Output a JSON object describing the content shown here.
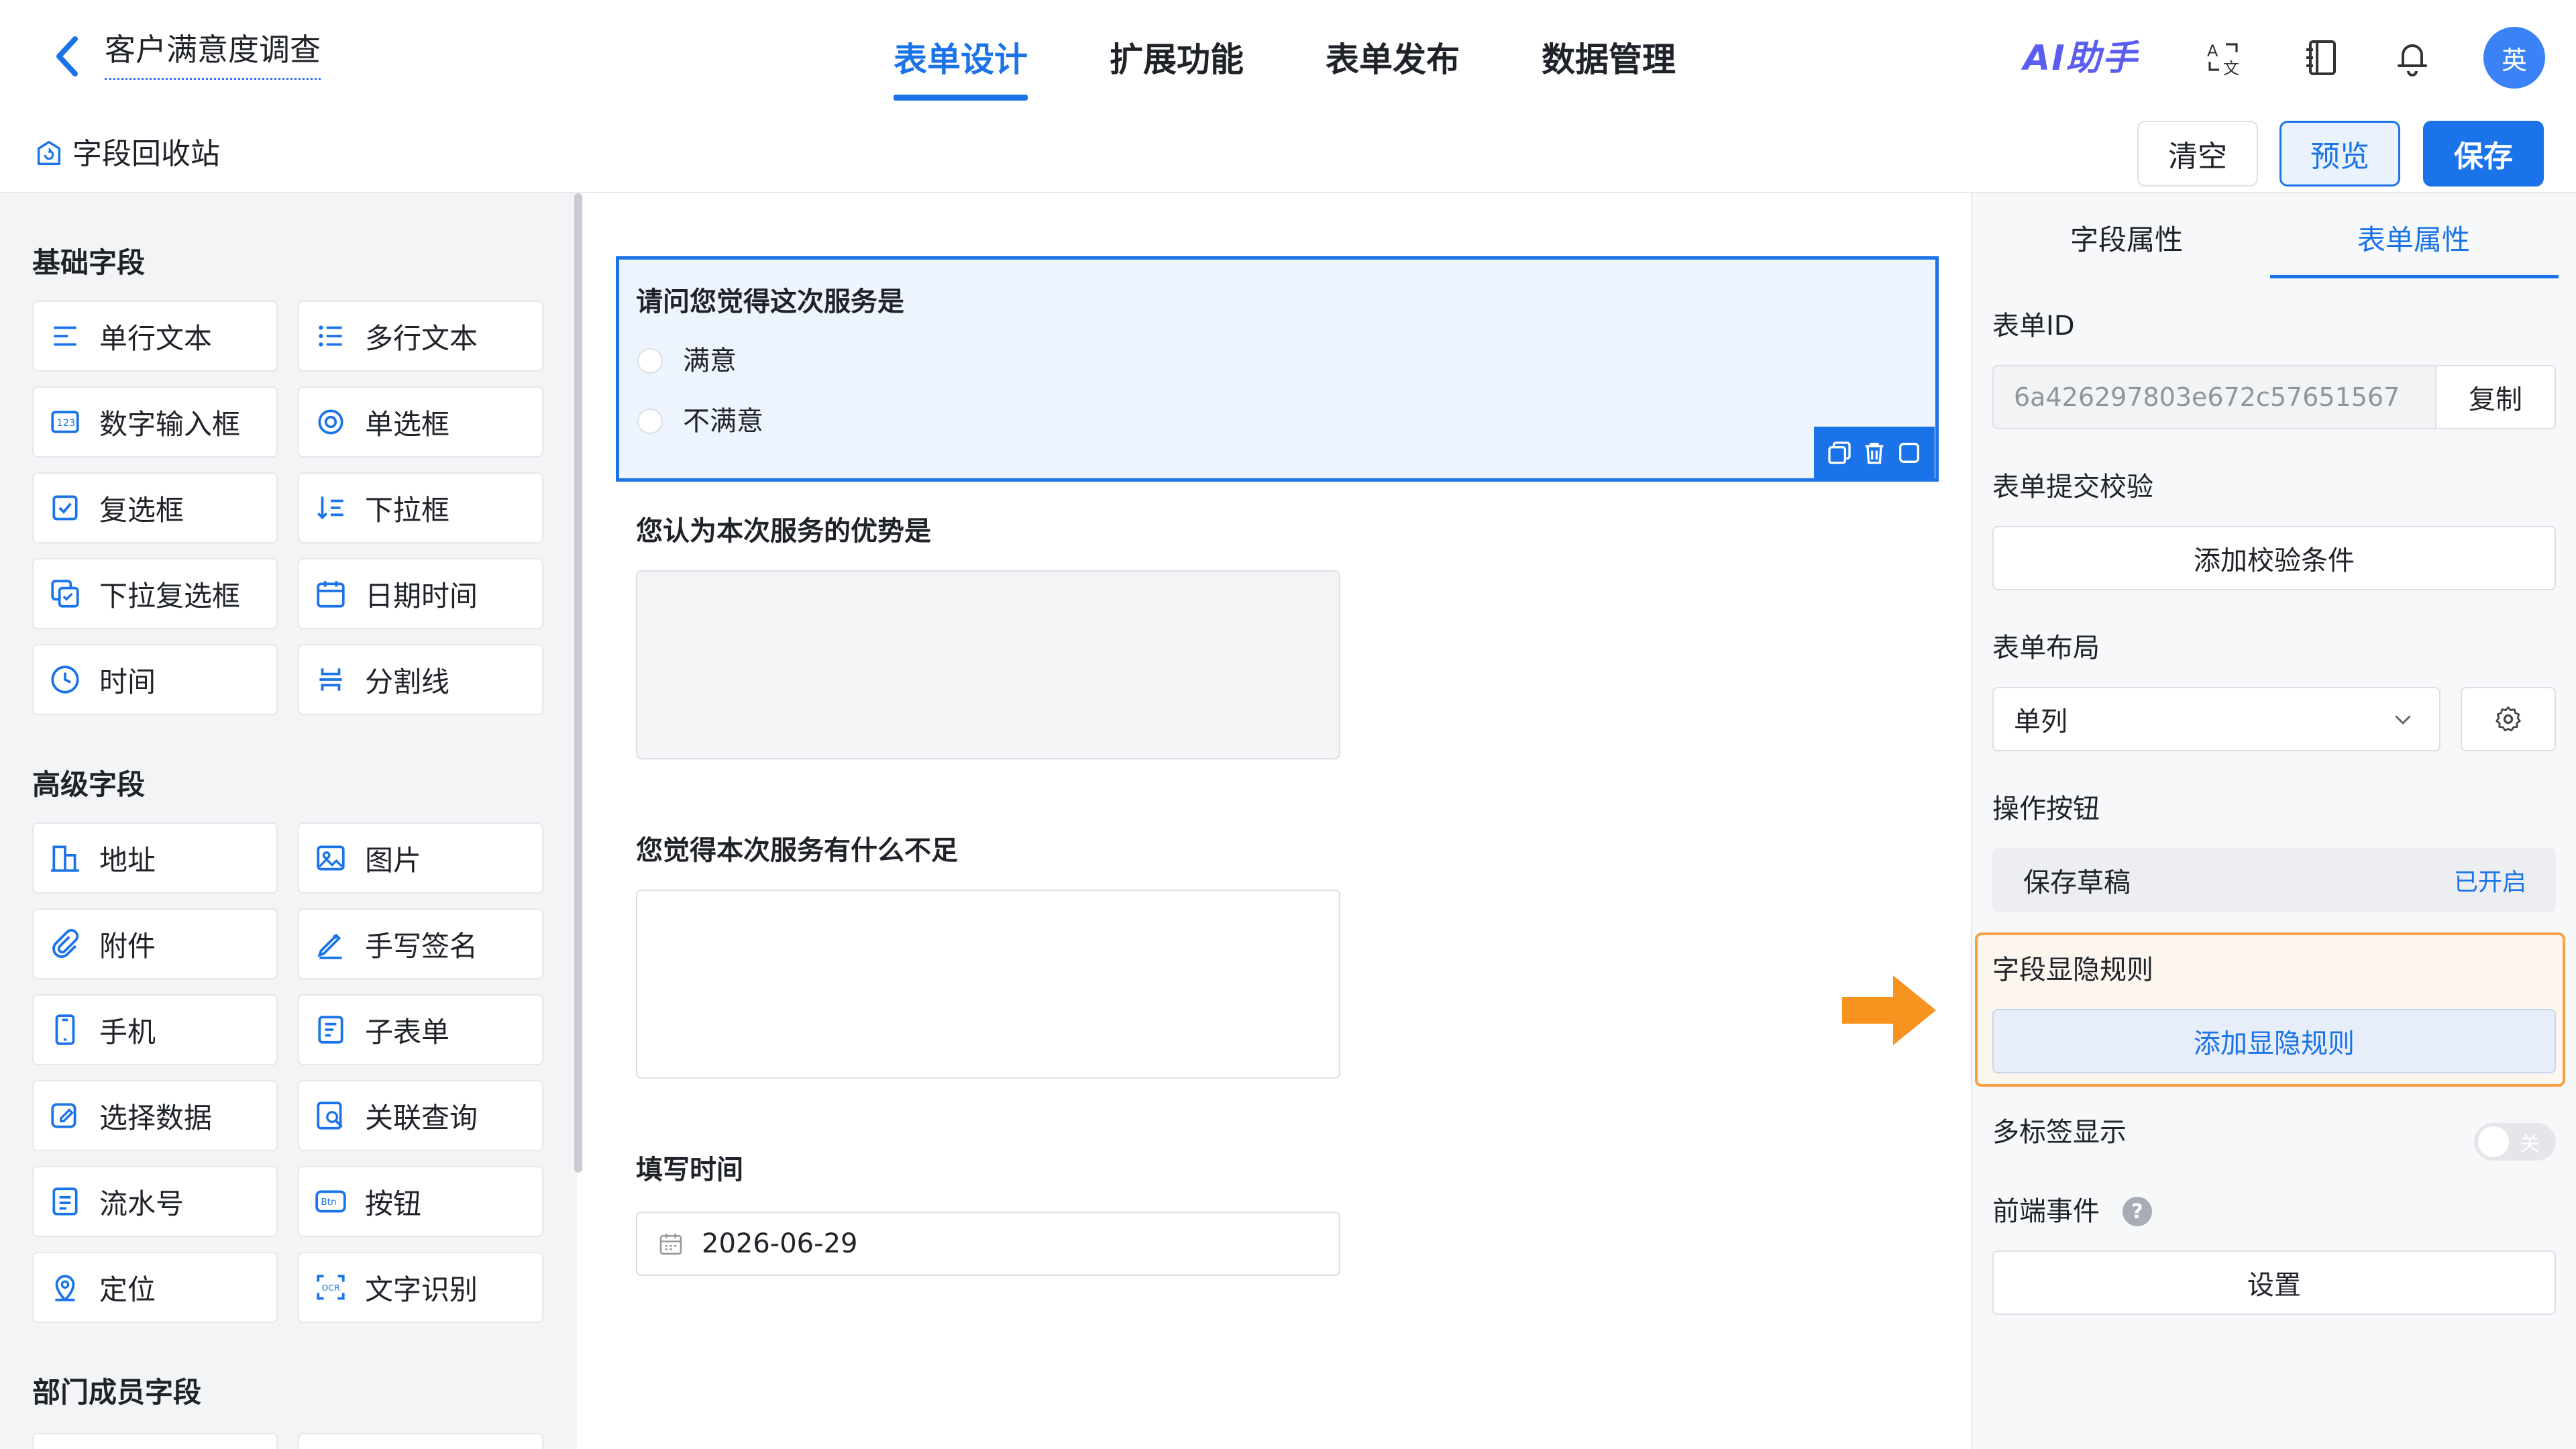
{
  "header": {
    "back_icon": "chevron-left-icon",
    "form_title": "客户满意度调查",
    "tabs": [
      {
        "label": "表单设计",
        "active": true
      },
      {
        "label": "扩展功能",
        "active": false
      },
      {
        "label": "表单发布",
        "active": false
      },
      {
        "label": "数据管理",
        "active": false
      }
    ],
    "ai_assistant": "AI助手",
    "icons": [
      "translate-icon",
      "book-icon",
      "bell-icon"
    ],
    "avatar_text": "英"
  },
  "toolbar": {
    "recycle_label": "字段回收站",
    "clear_label": "清空",
    "preview_label": "预览",
    "save_label": "保存"
  },
  "left_panel": {
    "basic_title": "基础字段",
    "basic_fields": [
      {
        "label": "单行文本",
        "icon": "single-line-text-icon"
      },
      {
        "label": "多行文本",
        "icon": "multi-line-text-icon"
      },
      {
        "label": "数字输入框",
        "icon": "number-input-icon"
      },
      {
        "label": "单选框",
        "icon": "radio-icon"
      },
      {
        "label": "复选框",
        "icon": "checkbox-icon"
      },
      {
        "label": "下拉框",
        "icon": "dropdown-icon"
      },
      {
        "label": "下拉复选框",
        "icon": "dropdown-checkbox-icon"
      },
      {
        "label": "日期时间",
        "icon": "calendar-icon"
      },
      {
        "label": "时间",
        "icon": "clock-icon"
      },
      {
        "label": "分割线",
        "icon": "divider-icon"
      }
    ],
    "advanced_title": "高级字段",
    "advanced_fields": [
      {
        "label": "地址",
        "icon": "address-icon"
      },
      {
        "label": "图片",
        "icon": "image-icon"
      },
      {
        "label": "附件",
        "icon": "attachment-icon"
      },
      {
        "label": "手写签名",
        "icon": "signature-icon"
      },
      {
        "label": "手机",
        "icon": "phone-icon"
      },
      {
        "label": "子表单",
        "icon": "subform-icon"
      },
      {
        "label": "选择数据",
        "icon": "select-data-icon"
      },
      {
        "label": "关联查询",
        "icon": "linked-query-icon"
      },
      {
        "label": "流水号",
        "icon": "serial-number-icon"
      },
      {
        "label": "按钮",
        "icon": "button-icon"
      },
      {
        "label": "定位",
        "icon": "location-icon"
      },
      {
        "label": "文字识别",
        "icon": "ocr-icon"
      }
    ],
    "dept_title": "部门成员字段"
  },
  "canvas": {
    "q1": {
      "label": "请问您觉得这次服务是",
      "options": [
        "满意",
        "不满意"
      ]
    },
    "q2": {
      "label": "您认为本次服务的优势是"
    },
    "q3": {
      "label": "您觉得本次服务有什么不足"
    },
    "q4": {
      "label": "填写时间",
      "value": "2026-06-29"
    },
    "block_action_icons": [
      "copy-icon",
      "trash-icon",
      "square-icon"
    ]
  },
  "right_panel": {
    "tabs": [
      {
        "label": "字段属性",
        "active": false
      },
      {
        "label": "表单属性",
        "active": true
      }
    ],
    "form_id_label": "表单ID",
    "form_id_value": "6a426297803e672c57651567",
    "copy_label": "复制",
    "validation_label": "表单提交校验",
    "add_validation_label": "添加校验条件",
    "layout_label": "表单布局",
    "layout_value": "单列",
    "op_buttons_label": "操作按钮",
    "save_draft_label": "保存草稿",
    "save_draft_status": "已开启",
    "visibility_label": "字段显隐规则",
    "add_visibility_label": "添加显隐规则",
    "multi_tab_label": "多标签显示",
    "multi_tab_toggle": "关",
    "frontend_event_label": "前端事件",
    "help_glyph": "?",
    "settings_label": "设置"
  },
  "colors": {
    "accent": "#1a73e8",
    "highlight": "#f7a044",
    "arrow": "#f7931e"
  }
}
